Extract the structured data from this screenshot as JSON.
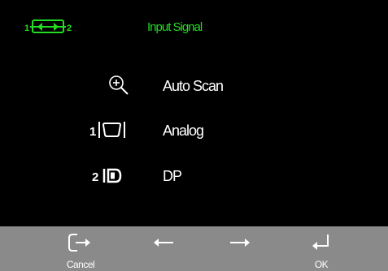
{
  "header": {
    "icon": "input-switch-icon",
    "icon_left_number": "1",
    "icon_right_number": "2",
    "title": "Input Signal"
  },
  "menu": {
    "items": [
      {
        "icon": "magnifier-icon",
        "label": "Auto Scan"
      },
      {
        "icon": "vga-port-icon",
        "number": "1",
        "label": "Analog"
      },
      {
        "icon": "displayport-icon",
        "number": "2",
        "label": "DP"
      }
    ]
  },
  "footer": {
    "cancel": {
      "icon": "exit-icon",
      "label": "Cancel"
    },
    "left": {
      "icon": "arrow-left-icon"
    },
    "right": {
      "icon": "arrow-right-icon"
    },
    "ok": {
      "icon": "enter-icon",
      "label": "OK"
    }
  },
  "colors": {
    "background": "#000000",
    "accent": "#22dd22",
    "footer": "#8a8a8a",
    "text": "#ffffff"
  }
}
